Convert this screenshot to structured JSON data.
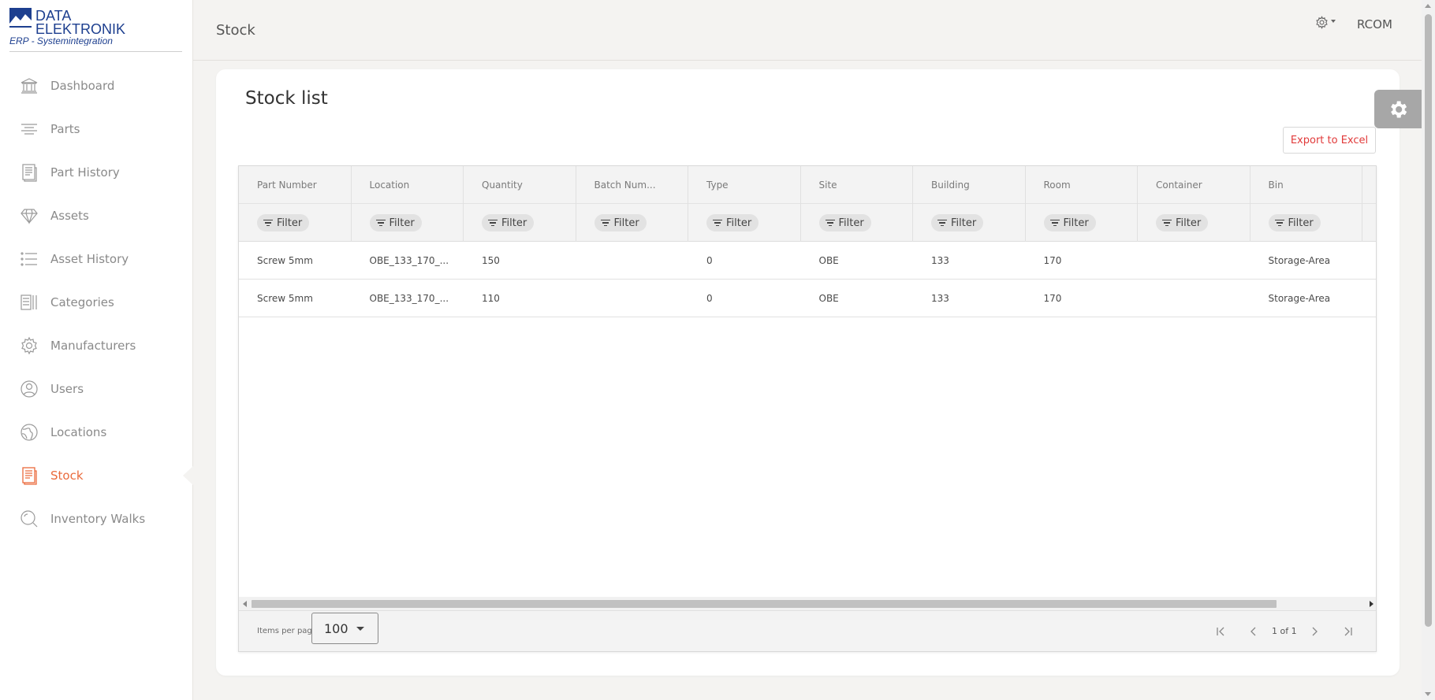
{
  "brand": {
    "line1": "DATA",
    "line2": "ELEKTRONIK",
    "tagline": "ERP - Systemintegration",
    "color": "#1d3f8f"
  },
  "sidebar": {
    "items": [
      {
        "label": "Dashboard",
        "icon": "bank-icon"
      },
      {
        "label": "Parts",
        "icon": "lines-icon"
      },
      {
        "label": "Part History",
        "icon": "document-icon"
      },
      {
        "label": "Assets",
        "icon": "diamond-icon"
      },
      {
        "label": "Asset History",
        "icon": "list-icon"
      },
      {
        "label": "Categories",
        "icon": "categories-icon"
      },
      {
        "label": "Manufacturers",
        "icon": "gear-icon"
      },
      {
        "label": "Users",
        "icon": "user-icon"
      },
      {
        "label": "Locations",
        "icon": "globe-icon"
      },
      {
        "label": "Stock",
        "icon": "stock-icon",
        "active": true
      },
      {
        "label": "Inventory Walks",
        "icon": "search-icon"
      }
    ],
    "active_color": "#ea6a3c"
  },
  "header": {
    "title": "Stock",
    "user": "RCOM"
  },
  "main": {
    "title": "Stock list",
    "export_label": "Export to Excel",
    "export_color": "#e13a3a"
  },
  "grid": {
    "columns": [
      "Part Number",
      "Location",
      "Quantity",
      "Batch Num...",
      "Type",
      "Site",
      "Building",
      "Room",
      "Container",
      "Bin"
    ],
    "filter_label": "Filter",
    "rows": [
      [
        "Screw 5mm",
        "OBE_133_170_...",
        "150",
        "",
        "0",
        "OBE",
        "133",
        "170",
        "",
        "Storage-Area"
      ],
      [
        "Screw 5mm",
        "OBE_133_170_...",
        "110",
        "",
        "0",
        "OBE",
        "133",
        "170",
        "",
        "Storage-Area"
      ]
    ]
  },
  "pager": {
    "items_per_page_label": "Items per page",
    "items_per_page_value": "100",
    "page_info": "1 of 1"
  }
}
